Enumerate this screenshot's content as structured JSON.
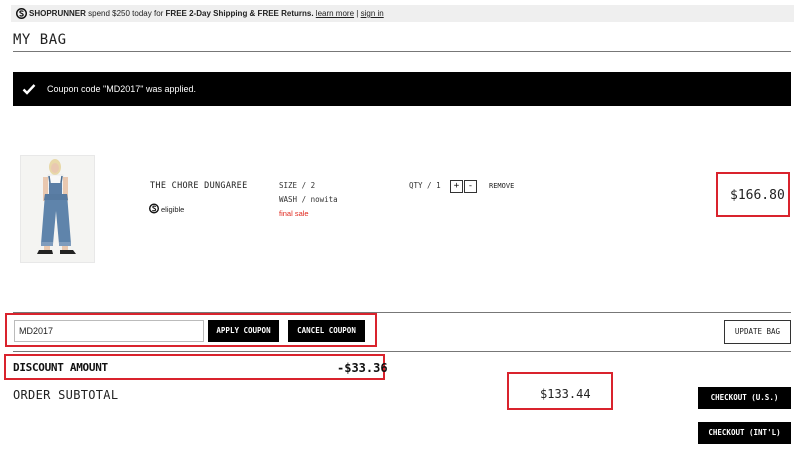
{
  "shoprunner": {
    "logo_icon": "shoprunner-logo-icon",
    "brand": "SHOPRUNNER",
    "promo_prefix": "spend $250 today for",
    "promo_bold": "FREE 2-Day Shipping & FREE Returns.",
    "learn_more": "learn more",
    "separator": "|",
    "sign_in": "sign in"
  },
  "page": {
    "title": "MY BAG"
  },
  "notice": {
    "icon": "checkmark-icon",
    "text": "Coupon code \"MD2017\" was applied."
  },
  "product": {
    "name": "THE CHORE DUNGAREE",
    "eligible_icon": "shoprunner-s-icon",
    "eligible_text": "eligible",
    "size": "SIZE / 2",
    "wash": "WASH / nowita",
    "final_sale": "final sale",
    "qty_label": "QTY / 1",
    "qty_plus": "+",
    "qty_minus": "-",
    "remove": "REMOVE",
    "price": "$166.80"
  },
  "coupon": {
    "input_value": "MD2017",
    "apply_label": "APPLY COUPON",
    "cancel_label": "CANCEL COUPON",
    "update_label": "UPDATE BAG"
  },
  "totals": {
    "discount_label": "DISCOUNT AMOUNT",
    "discount_value": "-$33.36",
    "subtotal_label": "ORDER SUBTOTAL",
    "subtotal_value": "$133.44",
    "checkout_us": "CHECKOUT (U.S.)",
    "checkout_intl": "CHECKOUT (INT'L)"
  },
  "colors": {
    "highlight": "#d9232d",
    "final_sale": "#e0281e",
    "notice_bg": "#000000"
  }
}
